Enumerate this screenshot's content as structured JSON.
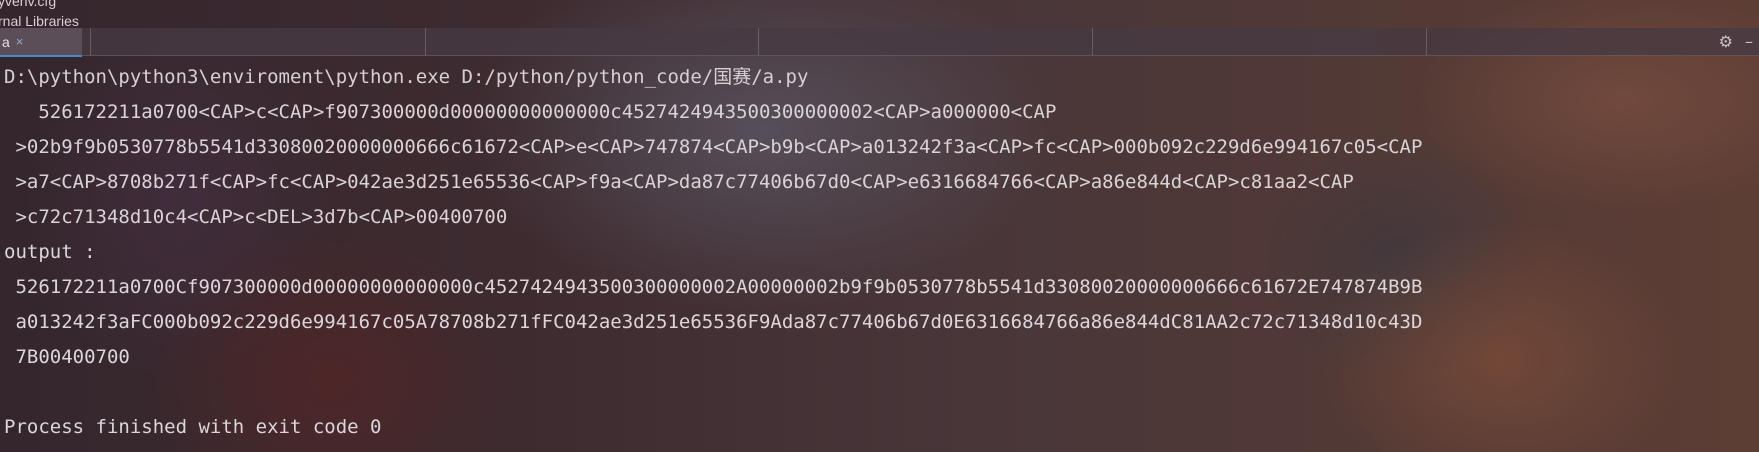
{
  "project_tree": {
    "row1": "yvenv.cfg",
    "row2": "rnal Libraries"
  },
  "tab": {
    "label": "a",
    "close_glyph": "×"
  },
  "toolbar": {
    "settings_icon": "gear-icon",
    "minimize_glyph": "–"
  },
  "console": {
    "command": "D:\\python\\python3\\enviroment\\python.exe D:/python/python_code/国赛/a.py",
    "input_lines": [
      "   526172211a0700<CAP>c<CAP>f907300000d00000000000000c4527424943500300000002<CAP>a000000<CAP",
      " >02b9f9b0530778b5541d33080020000000666c61672<CAP>e<CAP>747874<CAP>b9b<CAP>a013242f3a<CAP>fc<CAP>000b092c229d6e994167c05<CAP",
      " >a7<CAP>8708b271f<CAP>fc<CAP>042ae3d251e65536<CAP>f9a<CAP>da87c77406b67d0<CAP>e6316684766<CAP>a86e844d<CAP>c81aa2<CAP",
      " >c72c71348d10c4<CAP>c<DEL>3d7b<CAP>00400700"
    ],
    "output_label": "output :",
    "output_lines": [
      " 526172211a0700Cf907300000d00000000000000c4527424943500300000002A00000002b9f9b0530778b5541d33080020000000666c61672E747874B9B",
      " a013242f3aFC000b092c229d6e994167c05A78708b271fFC042ae3d251e65536F9Ada87c77406b67d0E6316684766a86e844dC81AA2c72c71348d10c43D",
      " 7B00400700"
    ],
    "exit_message": "Process finished with exit code 0"
  }
}
